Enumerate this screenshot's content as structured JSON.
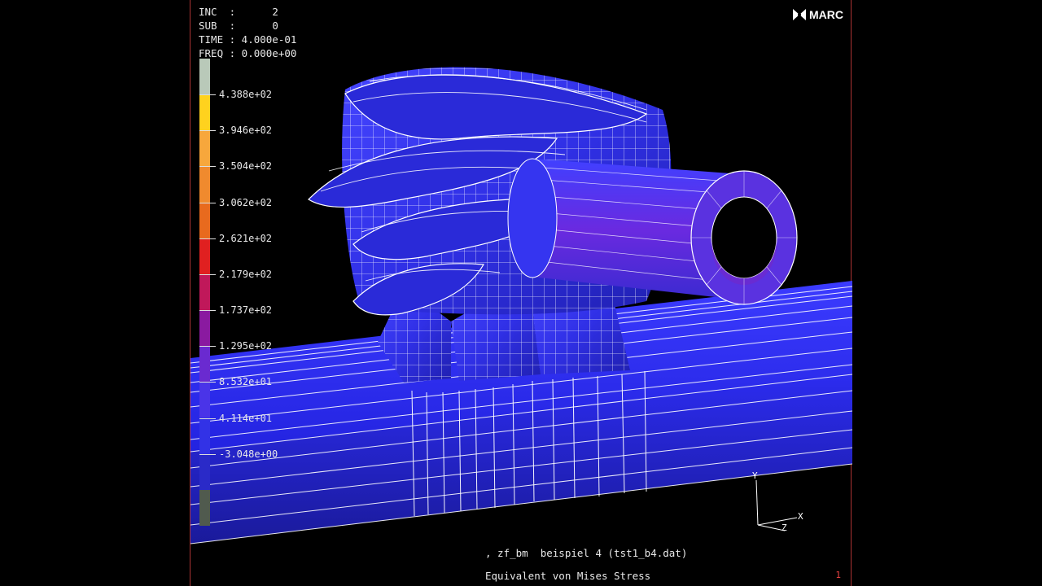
{
  "header": {
    "inc_key": "INC  :",
    "inc_val": "2",
    "sub_key": "SUB  :",
    "sub_val": "0",
    "time": "TIME : 4.000e-01",
    "freq": "FREQ : 0.000e+00"
  },
  "logo": {
    "text": "MARC"
  },
  "legend": {
    "labels": [
      "4.388e+02",
      "3.946e+02",
      "3.504e+02",
      "3.062e+02",
      "2.621e+02",
      "2.179e+02",
      "1.737e+02",
      "1.295e+02",
      "8.532e+01",
      "4.114e+01",
      "-3.048e+00"
    ],
    "colors": [
      "#b9c9b9",
      "#ffd21e",
      "#f7a73c",
      "#f08a2e",
      "#e86a1e",
      "#e02020",
      "#c0185a",
      "#8a1aa0",
      "#6a2ad0",
      "#4a34e8",
      "#3232e6",
      "#2a2ac8",
      "#505a4e"
    ]
  },
  "footer": {
    "job": ", zf_bm  beispiel 4 (tst1_b4.dat)",
    "quantity": "Equivalent von Mises Stress",
    "page": "1"
  },
  "axes": {
    "x": "X",
    "y": "Y",
    "z": "Z"
  }
}
